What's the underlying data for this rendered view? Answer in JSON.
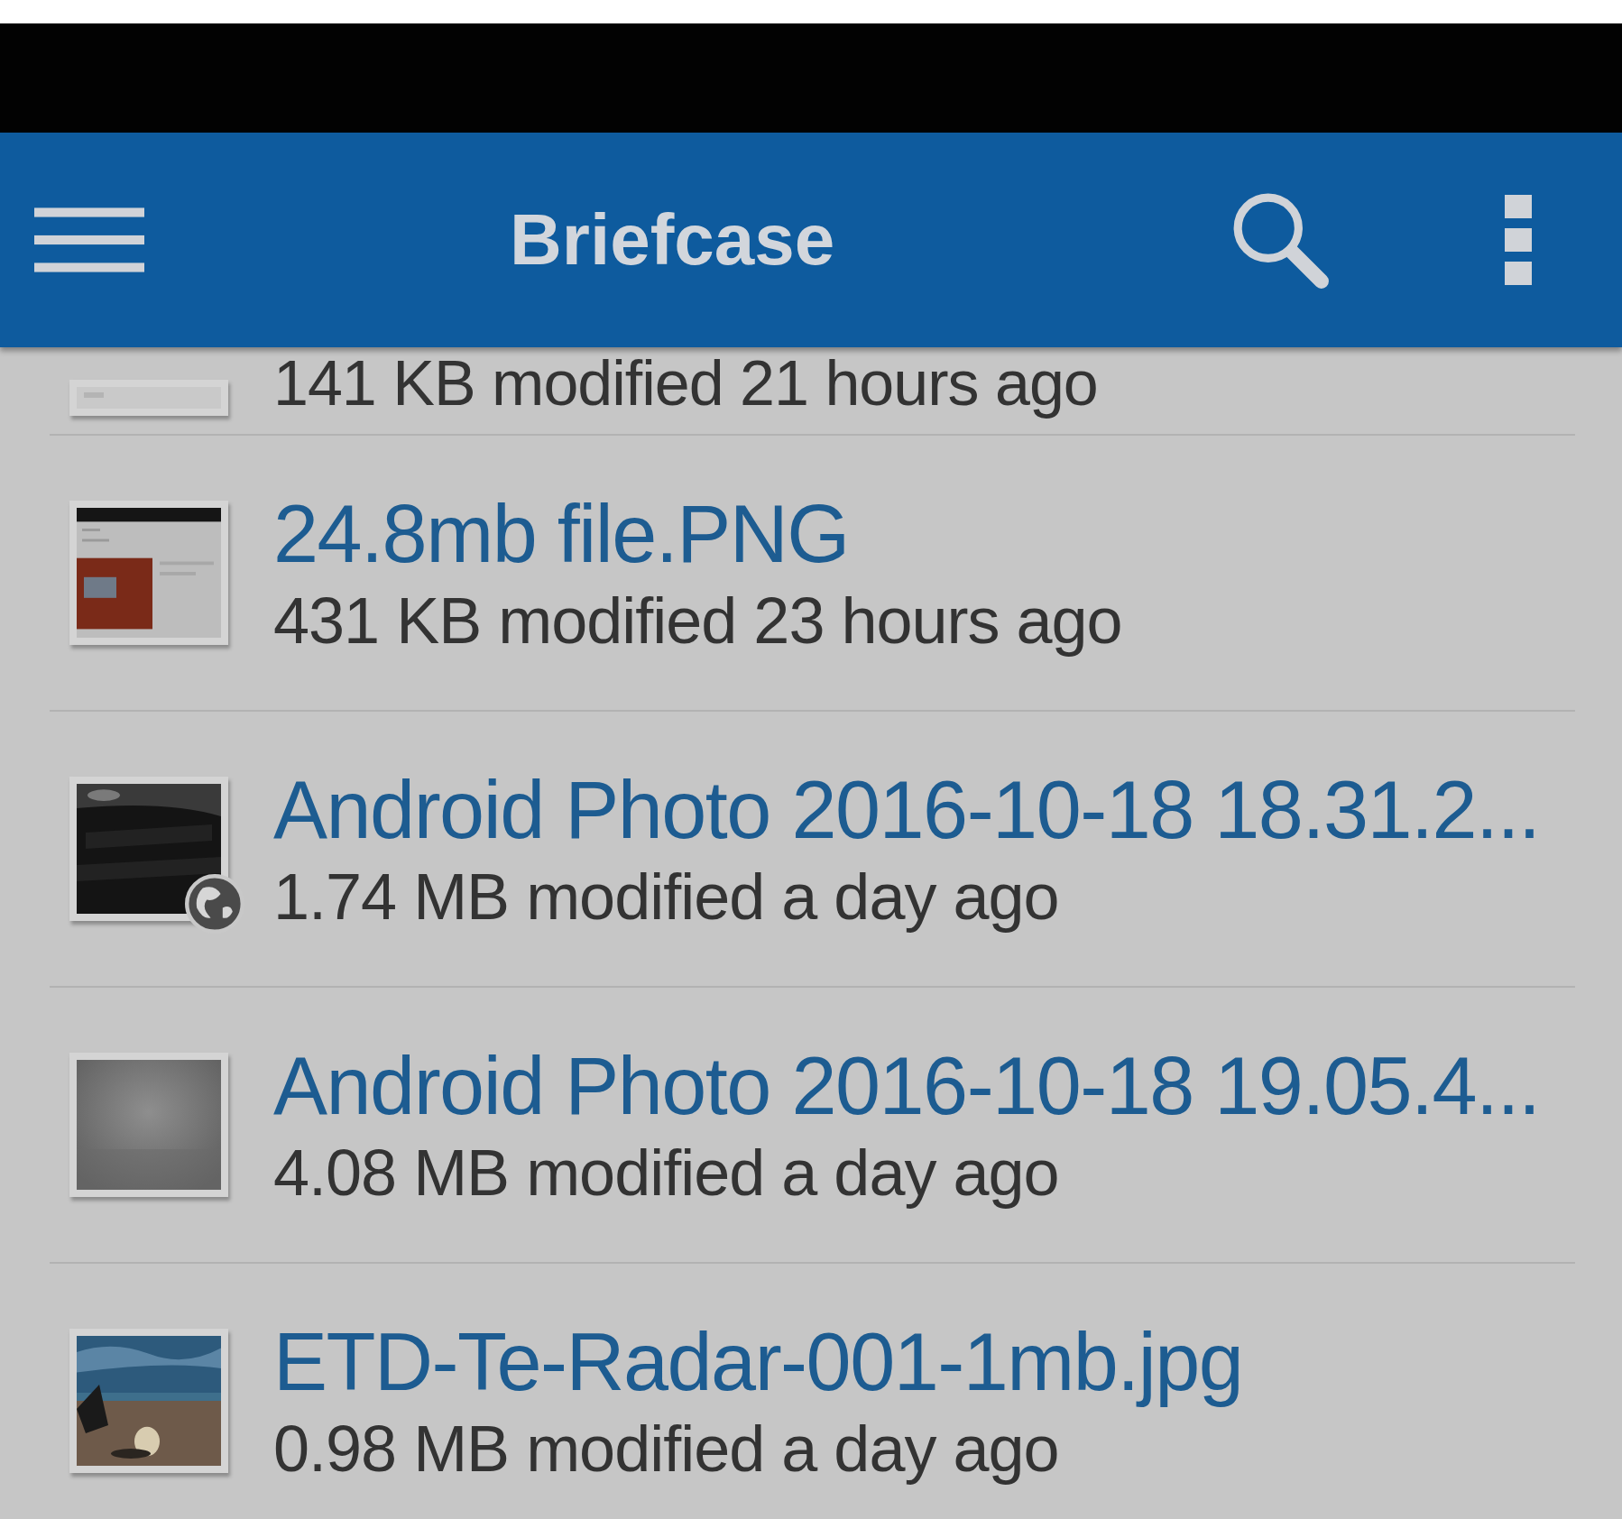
{
  "app_bar": {
    "title": "Briefcase"
  },
  "files": [
    {
      "details": "141 KB modified 21 hours ago",
      "shared": false
    },
    {
      "name": "24.8mb file.PNG",
      "details": "431 KB modified 23 hours ago",
      "shared": false
    },
    {
      "name": "Android Photo 2016-10-18 18.31.2...",
      "details": "1.74 MB modified a day ago",
      "shared": true
    },
    {
      "name": "Android Photo 2016-10-18 19.05.4...",
      "details": "4.08 MB modified a day ago",
      "shared": false
    },
    {
      "name": "ETD-Te-Radar-001-1mb.jpg",
      "details": "0.98 MB modified a day ago",
      "shared": false
    }
  ]
}
